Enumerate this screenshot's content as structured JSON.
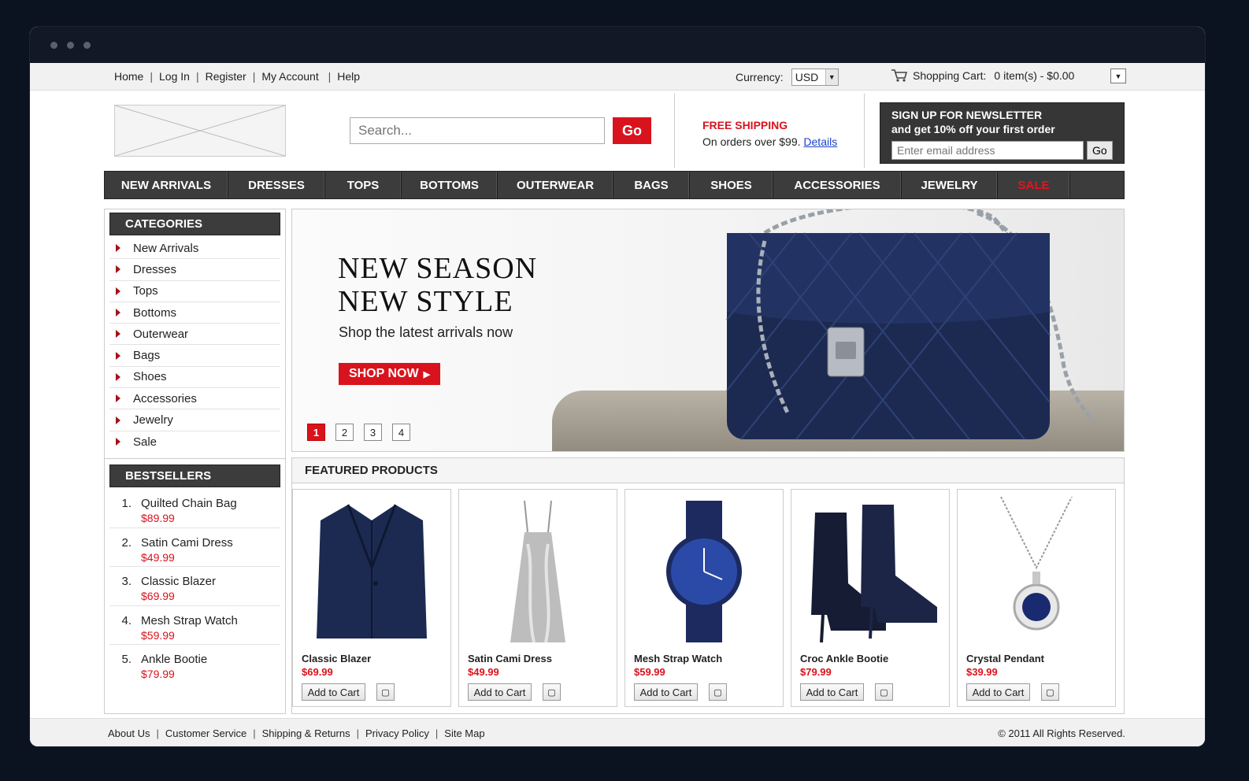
{
  "topbar": {
    "links": [
      "Home",
      "Log In",
      "Register",
      "My Account",
      "Help"
    ],
    "currency_label": "Currency:",
    "currency_value": "USD",
    "cart_label": "Shopping Cart:",
    "cart_summary": "0 item(s) - $0.00"
  },
  "header": {
    "search_placeholder": "Search...",
    "search_button": "Go",
    "shipping_title": "FREE SHIPPING",
    "shipping_text": "On orders over $99.",
    "shipping_link": "Details",
    "newsletter_line1": "SIGN UP FOR NEWSLETTER",
    "newsletter_line2": "and get 10% off your first order",
    "newsletter_placeholder": "Enter email address",
    "newsletter_button": "Go"
  },
  "nav": [
    "NEW ARRIVALS",
    "DRESSES",
    "TOPS",
    "BOTTOMS",
    "OUTERWEAR",
    "BAGS",
    "SHOES",
    "ACCESSORIES",
    "JEWELRY",
    "SALE"
  ],
  "sidebar": {
    "categories_title": "CATEGORIES",
    "categories": [
      "New Arrivals",
      "Dresses",
      "Tops",
      "Bottoms",
      "Outerwear",
      "Bags",
      "Shoes",
      "Accessories",
      "Jewelry",
      "Sale"
    ],
    "bestsellers_title": "BESTSELLERS",
    "bestsellers": [
      {
        "num": "1.",
        "name": "Quilted Chain Bag",
        "price": "$89.99"
      },
      {
        "num": "2.",
        "name": "Satin Cami Dress",
        "price": "$49.99"
      },
      {
        "num": "3.",
        "name": "Classic Blazer",
        "price": "$69.99"
      },
      {
        "num": "4.",
        "name": "Mesh Strap Watch",
        "price": "$59.99"
      },
      {
        "num": "5.",
        "name": "Ankle Bootie",
        "price": "$79.99"
      }
    ]
  },
  "banner": {
    "title_line1": "NEW SEASON",
    "title_line2": "NEW STYLE",
    "subtitle": "Shop the latest arrivals now",
    "cta": "SHOP NOW",
    "pages": [
      "1",
      "2",
      "3",
      "4"
    ],
    "active_page": "1"
  },
  "featured": {
    "title": "FEATURED PRODUCTS",
    "add_label": "Add to Cart",
    "products": [
      {
        "name": "Classic Blazer",
        "price": "$69.99",
        "icon": "blazer-icon"
      },
      {
        "name": "Satin Cami Dress",
        "price": "$49.99",
        "icon": "dress-icon"
      },
      {
        "name": "Mesh Strap Watch",
        "price": "$59.99",
        "icon": "watch-icon"
      },
      {
        "name": "Croc Ankle Bootie",
        "price": "$79.99",
        "icon": "boots-icon"
      },
      {
        "name": "Crystal Pendant",
        "price": "$39.99",
        "icon": "pendant-icon"
      }
    ]
  },
  "footer": {
    "links": [
      "About Us",
      "Customer Service",
      "Shipping & Returns",
      "Privacy Policy",
      "Site Map"
    ],
    "copyright": "© 2011 All Rights Reserved."
  },
  "colors": {
    "accent": "#d9131d",
    "nav_bg": "#3c3c3c",
    "link": "#1a44c9"
  }
}
